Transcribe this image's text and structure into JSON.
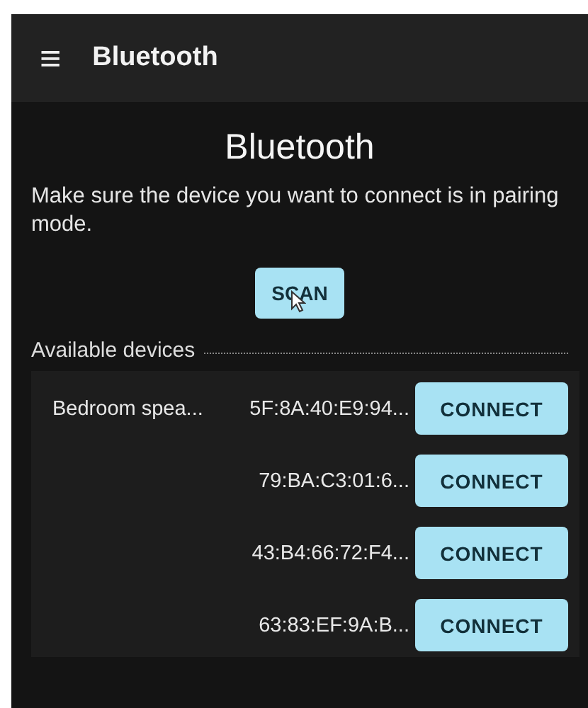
{
  "app_bar": {
    "menu_glyph": "≡",
    "title": "Bluetooth"
  },
  "heading": "Bluetooth",
  "instructions": "Make sure the device you want to connect is in pairing mode.",
  "scan_button": "SCAN",
  "section_label": "Available devices",
  "devices": [
    {
      "name": "Bedroom spea...",
      "address": "5F:8A:40:E9:94...",
      "button": "CONNECT"
    },
    {
      "address": "79:BA:C3:01:6...",
      "button": "CONNECT"
    },
    {
      "address": "43:B4:66:72:F4...",
      "button": "CONNECT"
    },
    {
      "address": "63:83:EF:9A:B...",
      "button": "CONNECT"
    }
  ]
}
